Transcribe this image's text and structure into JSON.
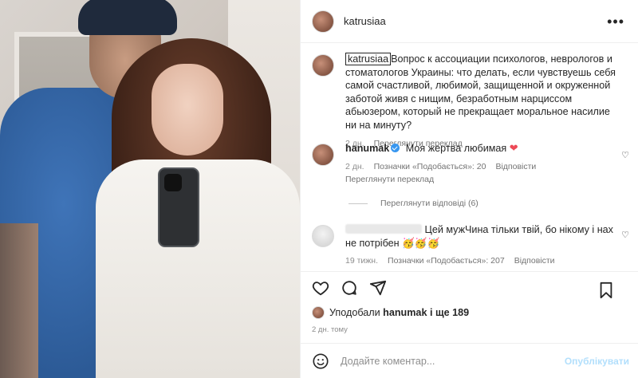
{
  "post": {
    "author": "katrusiaa",
    "more_icon": "more-horizontal-icon"
  },
  "caption": {
    "username": "katrusiaa",
    "text": "Вопрос к ассоциации психологов, неврологов и стоматологов Украины: что делать, если чувствуешь себя самой счастливой, любимой, защищенной и окруженной заботой живя с нищим, безработным нарциссом абьюзером, который не прекращает моральное насилие ни на минуту?",
    "time": "2 дн.",
    "translate": "Переглянути переклад"
  },
  "comments": [
    {
      "username": "hanumak",
      "verified": true,
      "text": "Моя жертва любимая",
      "emoji": "❤",
      "time": "2 дн.",
      "likes": "Позначки «Подобається»: 20",
      "reply": "Відповісти",
      "translate": "Переглянути переклад",
      "view_replies": "Переглянути відповіді (6)"
    },
    {
      "username": "",
      "text": "Цей мужЧина тільки твій, бо нікому і нах не потрібен",
      "emoji": "🥳🥳🥳",
      "time": "19 тижн.",
      "likes": "Позначки «Подобається»: 207",
      "reply": "Відповісти"
    }
  ],
  "likes_summary": {
    "prefix": "Уподобали",
    "user": "hanumak",
    "suffix": "і ще 189"
  },
  "post_time": "2 дн. тому",
  "add_comment": {
    "placeholder": "Додайте коментар...",
    "publish": "Опублікувати"
  },
  "colors": {
    "heart": "#ed4956",
    "verified": "#3897f0",
    "publish_disabled": "#b2dffc"
  }
}
